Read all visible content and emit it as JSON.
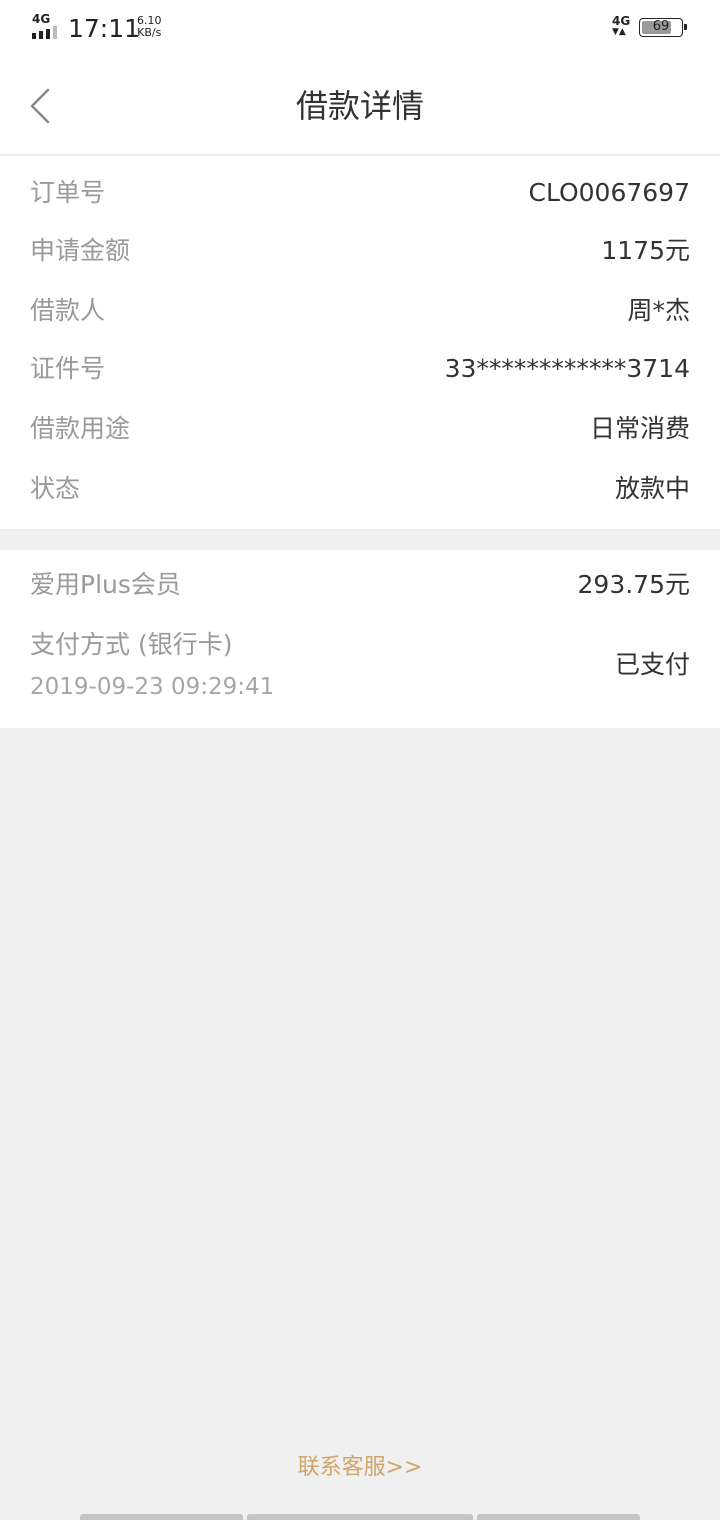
{
  "status_bar": {
    "network_left": "4G",
    "time": "17:11",
    "speed_value": "6.10",
    "speed_unit": "KB/s",
    "network_right": "4G",
    "battery": "69"
  },
  "header": {
    "back_icon": "chevron-left-icon",
    "title": "借款详情"
  },
  "loan_info": {
    "order_no_label": "订单号",
    "order_no_value": "CLO0067697",
    "amount_label": "申请金额",
    "amount_value": "1175元",
    "borrower_label": "借款人",
    "borrower_value": "周*杰",
    "id_label": "证件号",
    "id_value": "33************3714",
    "purpose_label": "借款用途",
    "purpose_value": "日常消费",
    "status_label": "状态",
    "status_value": "放款中"
  },
  "membership": {
    "member_label": "爱用Plus会员",
    "member_value": "293.75元",
    "payment_label": "支付方式 (银行卡)",
    "payment_time": "2019-09-23 09:29:41",
    "payment_status": "已支付"
  },
  "footer": {
    "contact_label": "联系客服>>"
  },
  "colors": {
    "background": "#f0f0f0",
    "card": "#ffffff",
    "label": "#9a9a9a",
    "value": "#333333",
    "link": "#d1a46a"
  }
}
